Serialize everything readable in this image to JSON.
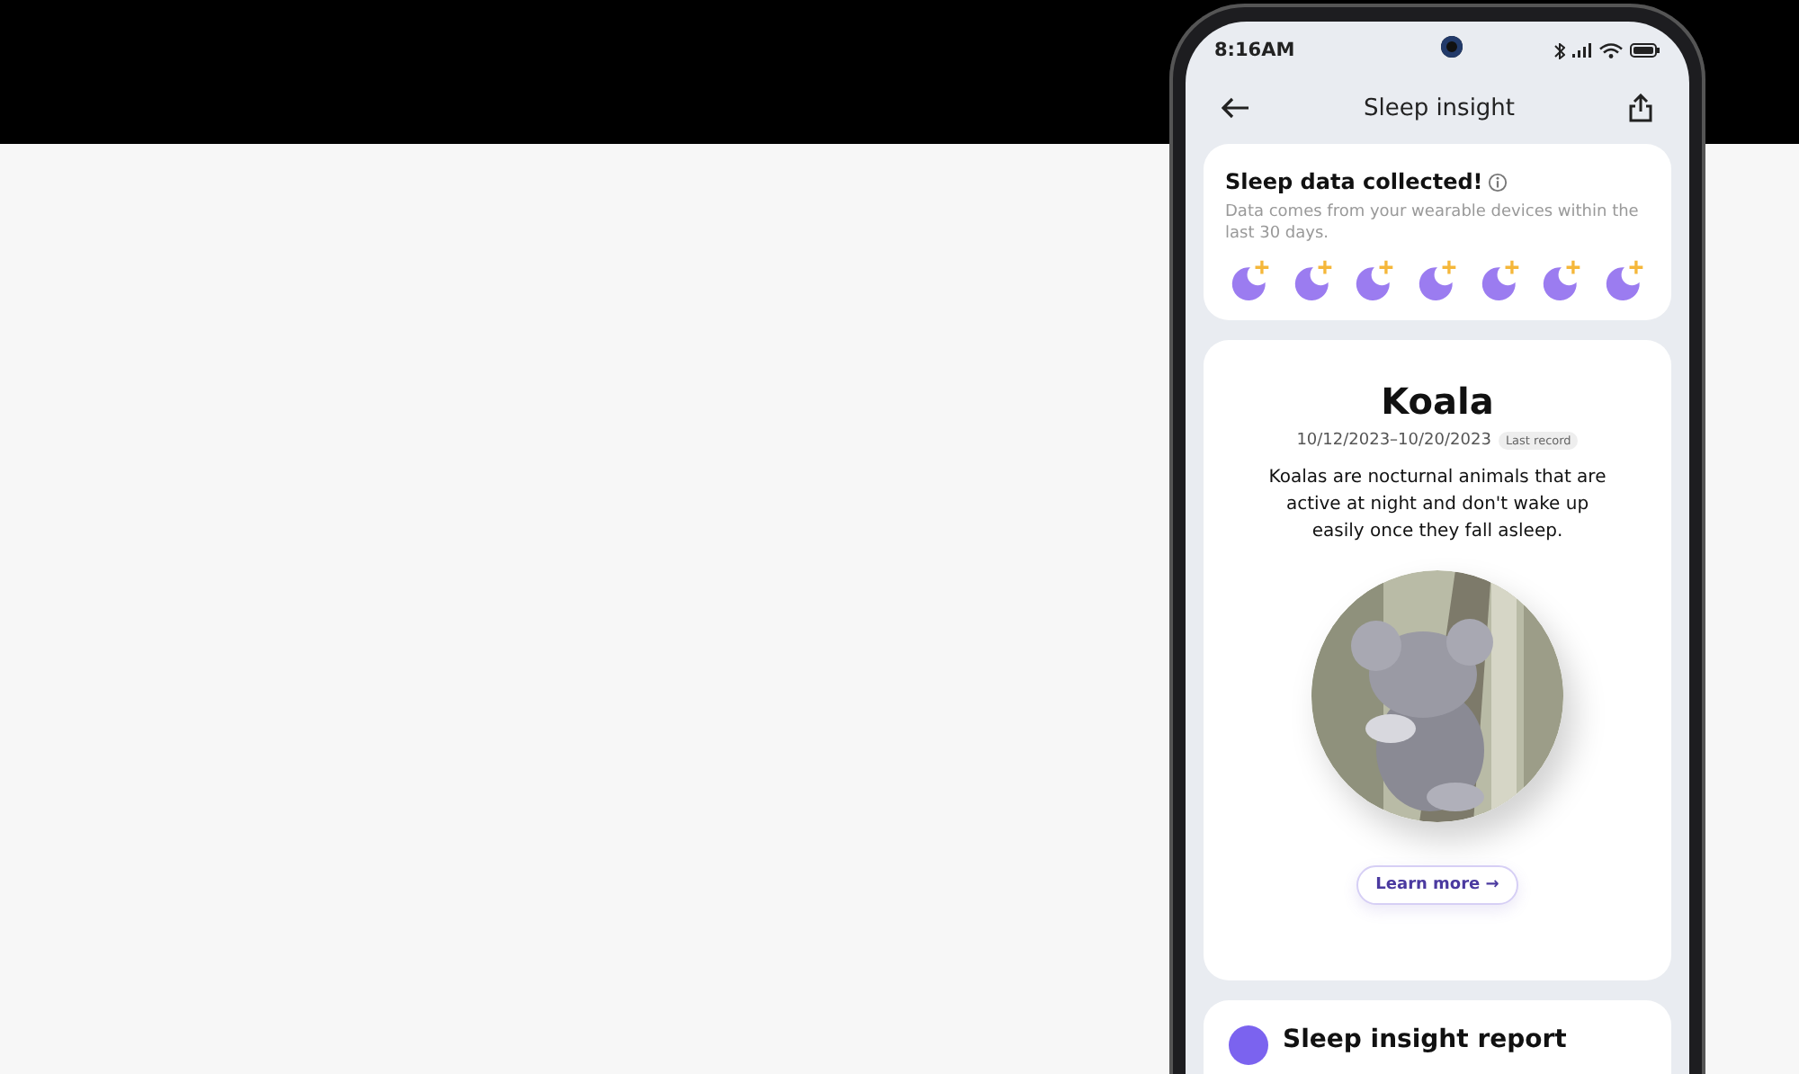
{
  "status_bar": {
    "time": "8:16AM"
  },
  "header": {
    "title": "Sleep insight"
  },
  "collected_card": {
    "title": "Sleep data collected!",
    "description": "Data comes from your wearable devices within the last 30 days.",
    "moons": [
      {
        "filled": true
      },
      {
        "filled": true
      },
      {
        "filled": true
      },
      {
        "filled": true
      },
      {
        "filled": true
      },
      {
        "filled": true
      },
      {
        "filled": true
      }
    ]
  },
  "animal_card": {
    "name": "Koala",
    "date_range": "10/12/2023–10/20/2023",
    "badge": "Last record",
    "description": "Koalas are nocturnal animals that are active at night and don't wake up easily once they fall asleep.",
    "button": "Learn more →"
  },
  "report_card": {
    "title": "Sleep insight report"
  }
}
